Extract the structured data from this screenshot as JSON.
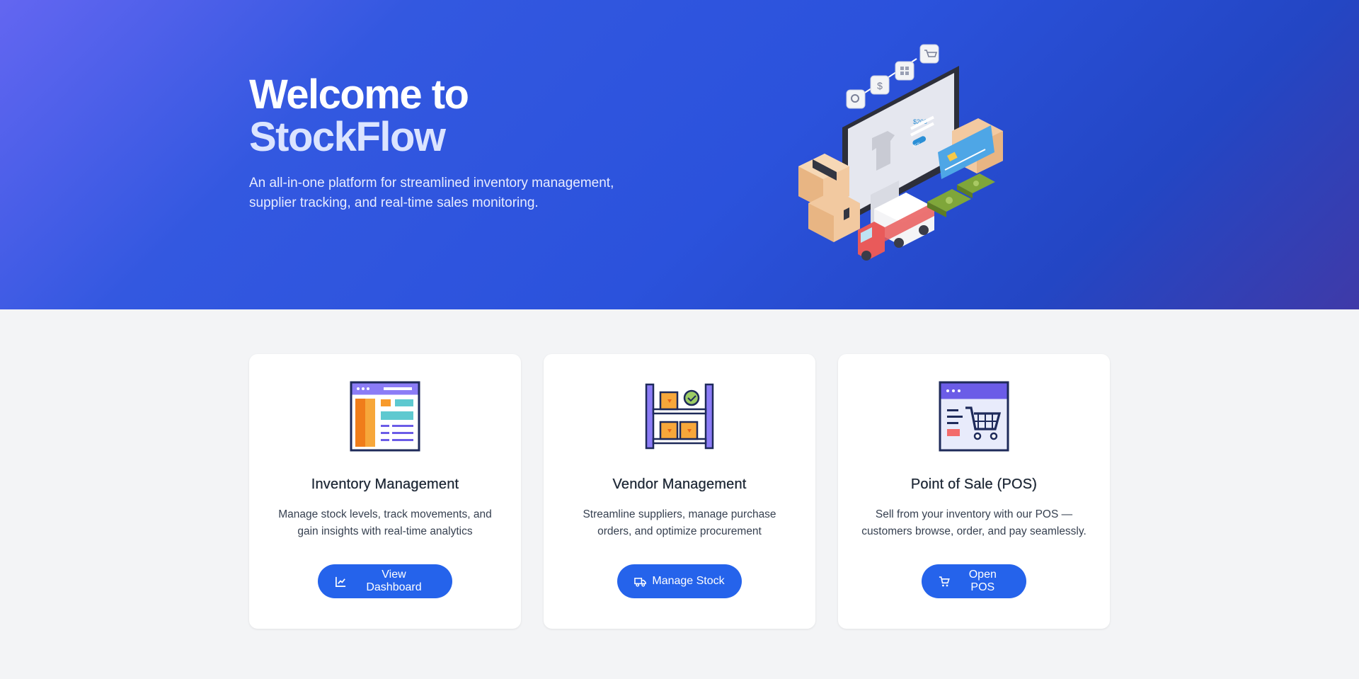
{
  "hero": {
    "title_line1": "Welcome to",
    "title_line2": "StockFlow",
    "subtitle": "An all-in-one platform for streamlined inventory management, supplier tracking, and real-time sales monitoring.",
    "illustration_icon": "ecommerce-illustration",
    "illustration_price": "$200",
    "illustration_button": "BUY"
  },
  "cards": [
    {
      "icon": "dashboard-window-icon",
      "title": "Inventory Management",
      "description": "Manage stock levels, track movements, and gain insights with real-time analytics",
      "button_label": "View Dashboard",
      "button_icon": "chart-line-icon"
    },
    {
      "icon": "warehouse-shelf-icon",
      "title": "Vendor Management",
      "description": "Streamline suppliers, manage purchase orders, and optimize procurement",
      "button_label": "Manage Stock",
      "button_icon": "truck-icon"
    },
    {
      "icon": "shop-cart-window-icon",
      "title": "Point of Sale (POS)",
      "description": "Sell from your inventory with our POS — customers browse, order, and pay seamlessly.",
      "button_label": "Open POS",
      "button_icon": "cart-icon"
    }
  ],
  "colors": {
    "hero_gradient_start": "#6366f1",
    "hero_gradient_end": "#2346c4",
    "primary_button": "#2563eb",
    "page_background": "#f3f4f6",
    "card_background": "#ffffff"
  }
}
